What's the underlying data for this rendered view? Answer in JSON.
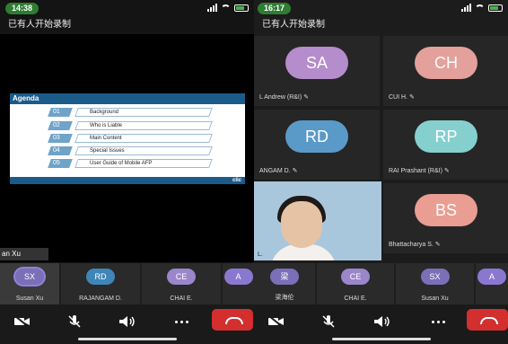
{
  "left": {
    "status_time": "14:38",
    "recording_text": "已有人开始录制",
    "slide": {
      "title": "Agenda",
      "items": [
        {
          "num": "01",
          "label": "Background"
        },
        {
          "num": "02",
          "label": "Who is Liable"
        },
        {
          "num": "03",
          "label": "Main Content"
        },
        {
          "num": "04",
          "label": "Special Issues"
        },
        {
          "num": "05",
          "label": "User Guide of Mobile AFP"
        }
      ],
      "logo": "clic"
    },
    "speaker_label": "an Xu",
    "participants": [
      {
        "initials": "SX",
        "name": "Susan Xu",
        "color": "#7b6fb8",
        "active": true
      },
      {
        "initials": "RD",
        "name": "RAJANGAM D.",
        "color": "#3f86b8",
        "active": false
      },
      {
        "initials": "CE",
        "name": "CHAI E.",
        "color": "#9b86cc",
        "active": false
      },
      {
        "initials": "A",
        "name": "",
        "color": "#8a78d0",
        "active": false
      }
    ]
  },
  "right": {
    "status_time": "16:17",
    "recording_text": "已有人开始录制",
    "tiles": [
      {
        "initials": "SA",
        "name": "L Andrew (R&I)",
        "color": "#b58ccc"
      },
      {
        "initials": "CH",
        "name": "CUI H.",
        "color": "#e4a09a"
      },
      {
        "initials": "RD",
        "name": "ANGAM D.",
        "color": "#5a9ac8"
      },
      {
        "initials": "RP",
        "name": "RAI Prashant (R&I)",
        "color": "#86cfcf"
      },
      {
        "initials": "BS",
        "name": "Bhattacharya S.",
        "color": "#ea9d92"
      }
    ],
    "video_label": "L.",
    "participants": [
      {
        "initials": "梁",
        "name": "梁海伦",
        "color": "#7b6fb8"
      },
      {
        "initials": "CE",
        "name": "CHAI E.",
        "color": "#9b86cc"
      },
      {
        "initials": "SX",
        "name": "Susan Xu",
        "color": "#7b6fb8"
      },
      {
        "initials": "A",
        "name": "",
        "color": "#8a78d0"
      }
    ]
  }
}
